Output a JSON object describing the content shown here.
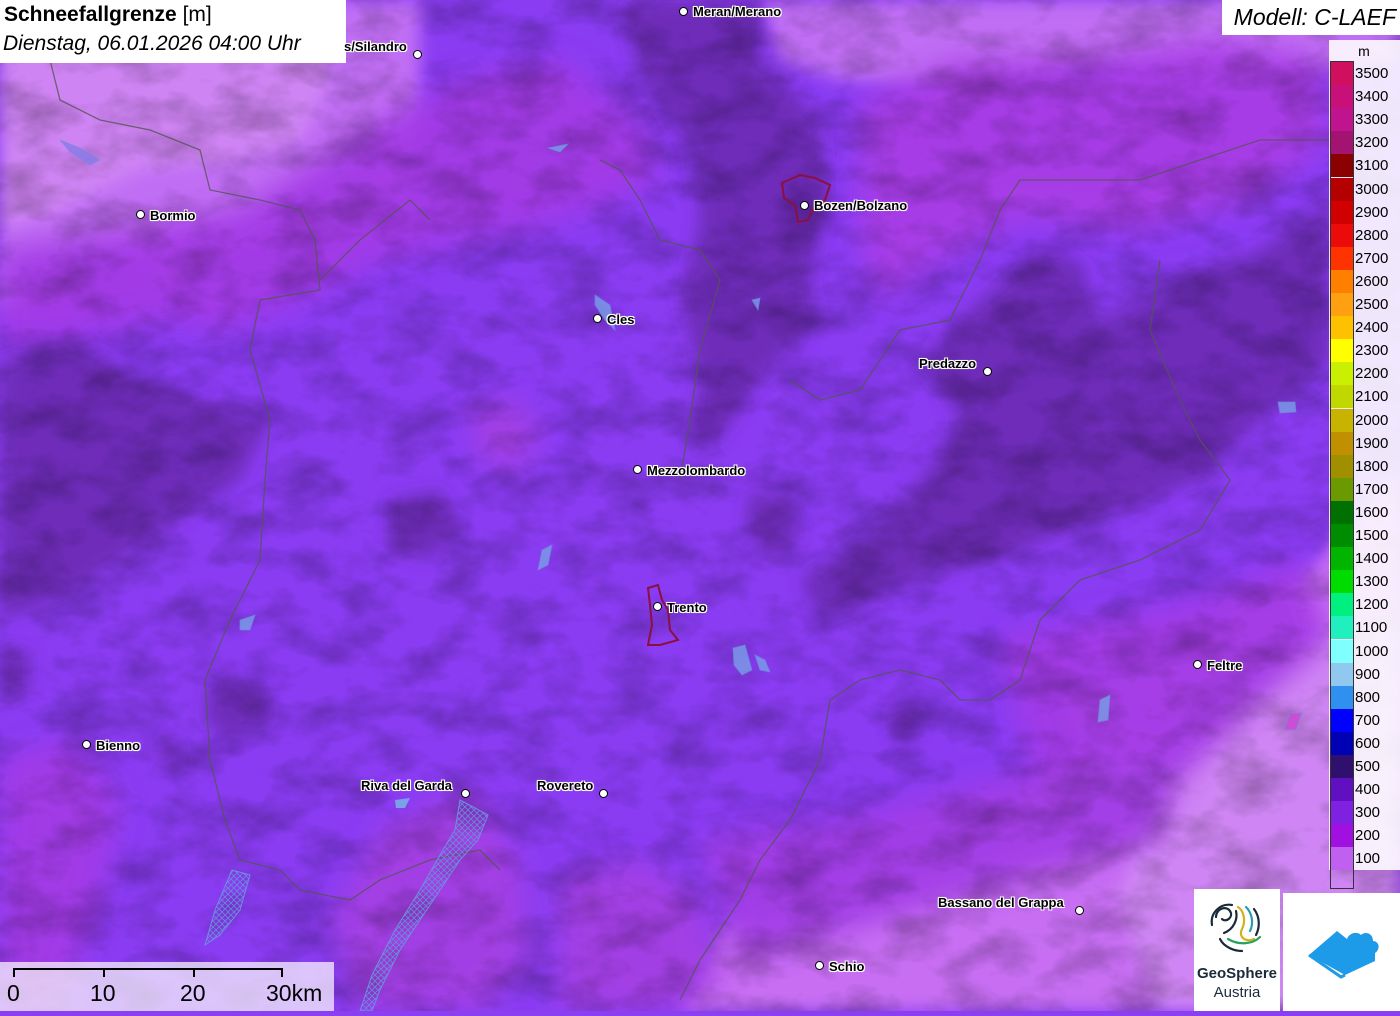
{
  "header": {
    "title": "Schneefallgrenze",
    "unit": "[m]",
    "time": "Dienstag, 06.01.2026 04:00 Uhr"
  },
  "model": {
    "label": "Modell: C-LAEF"
  },
  "legend": {
    "unit": "m",
    "entries": [
      {
        "label": "3500",
        "color": "#d0105e"
      },
      {
        "label": "3400",
        "color": "#c90f7a"
      },
      {
        "label": "3300",
        "color": "#c01390"
      },
      {
        "label": "3200",
        "color": "#a21372"
      },
      {
        "label": "3100",
        "color": "#8b0000"
      },
      {
        "label": "3000",
        "color": "#b40000"
      },
      {
        "label": "2900",
        "color": "#d00000"
      },
      {
        "label": "2800",
        "color": "#ec0b0b"
      },
      {
        "label": "2700",
        "color": "#ff3300"
      },
      {
        "label": "2600",
        "color": "#ff8000"
      },
      {
        "label": "2500",
        "color": "#ffa010"
      },
      {
        "label": "2400",
        "color": "#ffc000"
      },
      {
        "label": "2300",
        "color": "#ffff00"
      },
      {
        "label": "2200",
        "color": "#c8f000"
      },
      {
        "label": "2100",
        "color": "#c0d800"
      },
      {
        "label": "2000",
        "color": "#c8b400"
      },
      {
        "label": "1900",
        "color": "#c09000"
      },
      {
        "label": "1800",
        "color": "#a09000"
      },
      {
        "label": "1700",
        "color": "#6a9a00"
      },
      {
        "label": "1600",
        "color": "#007000"
      },
      {
        "label": "1500",
        "color": "#008c00"
      },
      {
        "label": "1400",
        "color": "#00b400"
      },
      {
        "label": "1300",
        "color": "#00dc00"
      },
      {
        "label": "1200",
        "color": "#00f080"
      },
      {
        "label": "1100",
        "color": "#20f0c0"
      },
      {
        "label": "1000",
        "color": "#80ffff"
      },
      {
        "label": "900",
        "color": "#90c8f0"
      },
      {
        "label": "800",
        "color": "#3090f0"
      },
      {
        "label": "700",
        "color": "#0000ff"
      },
      {
        "label": "600",
        "color": "#0000b4"
      },
      {
        "label": "500",
        "color": "#30106e"
      },
      {
        "label": "400",
        "color": "#6010c0"
      },
      {
        "label": "300",
        "color": "#8020e0"
      },
      {
        "label": "200",
        "color": "#a010e0"
      },
      {
        "label": "100",
        "color": "#c060f0"
      }
    ]
  },
  "cities": [
    {
      "name": "Meran/Merano"
    },
    {
      "name": "s/Silandro"
    },
    {
      "name": "Bormio"
    },
    {
      "name": "Bozen/Bolzano"
    },
    {
      "name": "Cles"
    },
    {
      "name": "Predazzo"
    },
    {
      "name": "Mezzolombardo"
    },
    {
      "name": "Trento"
    },
    {
      "name": "Feltre"
    },
    {
      "name": "Bienno"
    },
    {
      "name": "Riva del Garda"
    },
    {
      "name": "Rovereto"
    },
    {
      "name": "Bassano del Grappa"
    },
    {
      "name": "Schio"
    }
  ],
  "scale": {
    "labels": [
      "0",
      "10",
      "20",
      "30km"
    ]
  },
  "logos": {
    "geosphere_line1": "GeoSphere",
    "geosphere_line2": "Austria"
  }
}
